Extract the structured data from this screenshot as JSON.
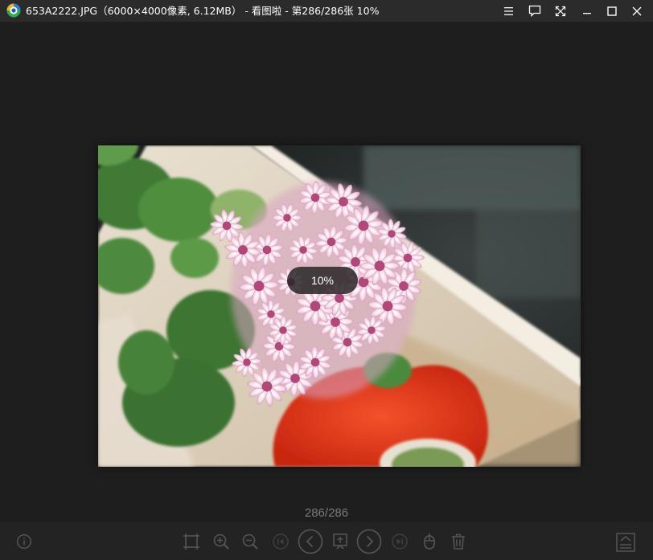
{
  "window": {
    "title": "653A2222.JPG（6000×4000像素, 6.12MB） - 看图啦 - 第286/286张 10%"
  },
  "titlebar_buttons": [
    "menu-icon",
    "feedback-icon",
    "fullscreen-icon",
    "minimize-icon",
    "maximize-icon",
    "close-icon"
  ],
  "viewer": {
    "zoom_badge": "10%",
    "page_counter": "286/286"
  },
  "toolbar": {
    "left": [
      "info-icon"
    ],
    "center": [
      "fit-window-icon",
      "zoom-in-icon",
      "zoom-out-icon",
      "first-image-icon",
      "previous-icon",
      "set-wallpaper-icon",
      "next-icon",
      "last-image-icon",
      "rotate-icon",
      "delete-icon"
    ],
    "right": [
      "collapse-toolbar-icon"
    ]
  },
  "colors": {
    "background": "#1e1e1e",
    "titlebar": "#2b2b2b",
    "toolbar": "#232323",
    "icon": "#555555",
    "counter_text": "#7a7a7a"
  }
}
